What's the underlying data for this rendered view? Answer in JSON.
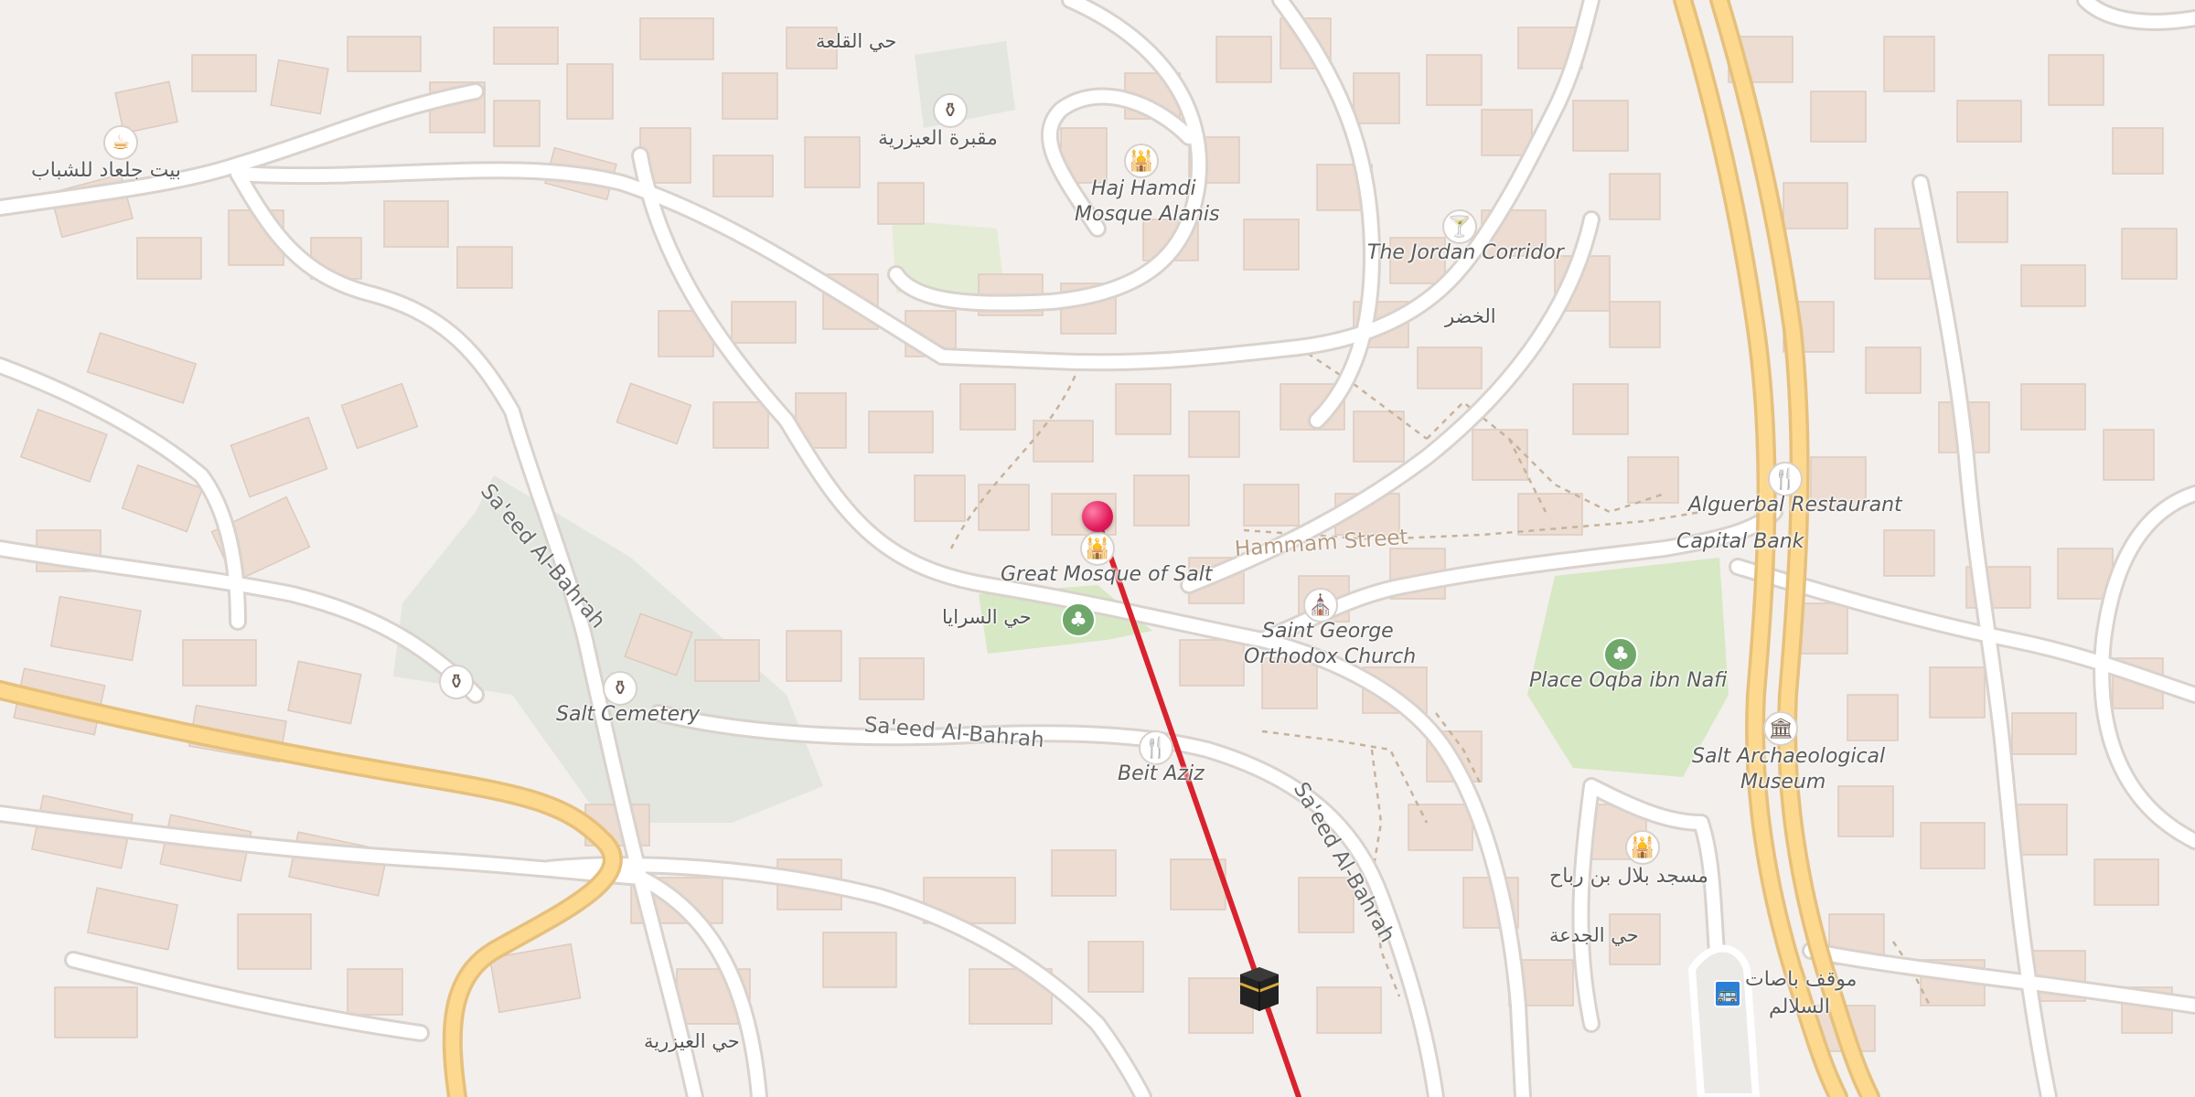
{
  "colors": {
    "land": "#f3efec",
    "building": "#ecdcd1",
    "park": "#d7e8c4",
    "cemetery": "#e2e6df",
    "road": "#ffffff",
    "highway": "#fcd98f",
    "route_line": "#d8232e",
    "pin": "#e0195a"
  },
  "streets": {
    "saeed_1": "Sa'eed Al-Bahrah",
    "saeed_2": "Sa'eed Al-Bahrah",
    "saeed_3": "Sa'eed Al-Bahrah",
    "hammam": "Hammam Street"
  },
  "areas": {
    "qalaa": "حي القلعة",
    "khidr": "الخضر",
    "saraya": "حي السرايا",
    "jadaa": "حي الجدعة",
    "aizriya": "حي العيزرية"
  },
  "pois": {
    "bayt_jalaad": {
      "label": "بيت جلعاد للشباب",
      "icon": "cafe-icon"
    },
    "maqbara": {
      "label": "مقبرة العيزرية",
      "icon": "cemetery-icon"
    },
    "haj_hamdi_1": {
      "label": "Haj Hamdi",
      "icon": "mosque-icon"
    },
    "haj_hamdi_2": {
      "label": "Mosque Alanis"
    },
    "jordan_corridor": {
      "label": "The Jordan Corridor",
      "icon": "bar-icon"
    },
    "great_mosque": {
      "label": "Great Mosque of Salt",
      "icon": "mosque-icon"
    },
    "st_george_1": {
      "label": "Saint George",
      "icon": "church-icon"
    },
    "st_george_2": {
      "label": "Orthodox Church"
    },
    "salt_cemetery": {
      "label": "Salt Cemetery",
      "icon": "cemetery-icon"
    },
    "beit_aziz": {
      "label": "Beit Aziz",
      "icon": "restaurant-icon"
    },
    "alguerbal": {
      "label": "Alguerbal Restaurant",
      "icon": "restaurant-icon"
    },
    "capital_bank": {
      "label": "Capital Bank"
    },
    "place_oqba": {
      "label": "Place Oqba ibn Nafi",
      "icon": "tree-icon"
    },
    "museum_1": {
      "label": "Salt Archaeological",
      "icon": "museum-icon"
    },
    "museum_2": {
      "label": "Museum"
    },
    "bilal_mosque": {
      "label": "مسجد بلال بن رباح",
      "icon": "mosque-icon"
    },
    "bus_1": {
      "label": "موقف باصات",
      "icon": "bus-stop-icon"
    },
    "bus_2": {
      "label": "السلالم"
    }
  },
  "markers": {
    "location_pin": "location-pin-icon",
    "qibla": "kaaba-icon"
  }
}
